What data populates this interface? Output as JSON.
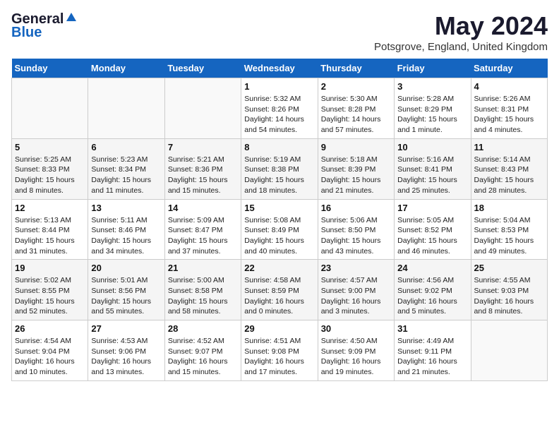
{
  "header": {
    "logo_general": "General",
    "logo_blue": "Blue",
    "main_title": "May 2024",
    "subtitle": "Potsgrove, England, United Kingdom"
  },
  "days_of_week": [
    "Sunday",
    "Monday",
    "Tuesday",
    "Wednesday",
    "Thursday",
    "Friday",
    "Saturday"
  ],
  "weeks": [
    {
      "days": [
        {
          "number": "",
          "info": ""
        },
        {
          "number": "",
          "info": ""
        },
        {
          "number": "",
          "info": ""
        },
        {
          "number": "1",
          "info": "Sunrise: 5:32 AM\nSunset: 8:26 PM\nDaylight: 14 hours\nand 54 minutes."
        },
        {
          "number": "2",
          "info": "Sunrise: 5:30 AM\nSunset: 8:28 PM\nDaylight: 14 hours\nand 57 minutes."
        },
        {
          "number": "3",
          "info": "Sunrise: 5:28 AM\nSunset: 8:29 PM\nDaylight: 15 hours\nand 1 minute."
        },
        {
          "number": "4",
          "info": "Sunrise: 5:26 AM\nSunset: 8:31 PM\nDaylight: 15 hours\nand 4 minutes."
        }
      ]
    },
    {
      "days": [
        {
          "number": "5",
          "info": "Sunrise: 5:25 AM\nSunset: 8:33 PM\nDaylight: 15 hours\nand 8 minutes."
        },
        {
          "number": "6",
          "info": "Sunrise: 5:23 AM\nSunset: 8:34 PM\nDaylight: 15 hours\nand 11 minutes."
        },
        {
          "number": "7",
          "info": "Sunrise: 5:21 AM\nSunset: 8:36 PM\nDaylight: 15 hours\nand 15 minutes."
        },
        {
          "number": "8",
          "info": "Sunrise: 5:19 AM\nSunset: 8:38 PM\nDaylight: 15 hours\nand 18 minutes."
        },
        {
          "number": "9",
          "info": "Sunrise: 5:18 AM\nSunset: 8:39 PM\nDaylight: 15 hours\nand 21 minutes."
        },
        {
          "number": "10",
          "info": "Sunrise: 5:16 AM\nSunset: 8:41 PM\nDaylight: 15 hours\nand 25 minutes."
        },
        {
          "number": "11",
          "info": "Sunrise: 5:14 AM\nSunset: 8:43 PM\nDaylight: 15 hours\nand 28 minutes."
        }
      ]
    },
    {
      "days": [
        {
          "number": "12",
          "info": "Sunrise: 5:13 AM\nSunset: 8:44 PM\nDaylight: 15 hours\nand 31 minutes."
        },
        {
          "number": "13",
          "info": "Sunrise: 5:11 AM\nSunset: 8:46 PM\nDaylight: 15 hours\nand 34 minutes."
        },
        {
          "number": "14",
          "info": "Sunrise: 5:09 AM\nSunset: 8:47 PM\nDaylight: 15 hours\nand 37 minutes."
        },
        {
          "number": "15",
          "info": "Sunrise: 5:08 AM\nSunset: 8:49 PM\nDaylight: 15 hours\nand 40 minutes."
        },
        {
          "number": "16",
          "info": "Sunrise: 5:06 AM\nSunset: 8:50 PM\nDaylight: 15 hours\nand 43 minutes."
        },
        {
          "number": "17",
          "info": "Sunrise: 5:05 AM\nSunset: 8:52 PM\nDaylight: 15 hours\nand 46 minutes."
        },
        {
          "number": "18",
          "info": "Sunrise: 5:04 AM\nSunset: 8:53 PM\nDaylight: 15 hours\nand 49 minutes."
        }
      ]
    },
    {
      "days": [
        {
          "number": "19",
          "info": "Sunrise: 5:02 AM\nSunset: 8:55 PM\nDaylight: 15 hours\nand 52 minutes."
        },
        {
          "number": "20",
          "info": "Sunrise: 5:01 AM\nSunset: 8:56 PM\nDaylight: 15 hours\nand 55 minutes."
        },
        {
          "number": "21",
          "info": "Sunrise: 5:00 AM\nSunset: 8:58 PM\nDaylight: 15 hours\nand 58 minutes."
        },
        {
          "number": "22",
          "info": "Sunrise: 4:58 AM\nSunset: 8:59 PM\nDaylight: 16 hours\nand 0 minutes."
        },
        {
          "number": "23",
          "info": "Sunrise: 4:57 AM\nSunset: 9:00 PM\nDaylight: 16 hours\nand 3 minutes."
        },
        {
          "number": "24",
          "info": "Sunrise: 4:56 AM\nSunset: 9:02 PM\nDaylight: 16 hours\nand 5 minutes."
        },
        {
          "number": "25",
          "info": "Sunrise: 4:55 AM\nSunset: 9:03 PM\nDaylight: 16 hours\nand 8 minutes."
        }
      ]
    },
    {
      "days": [
        {
          "number": "26",
          "info": "Sunrise: 4:54 AM\nSunset: 9:04 PM\nDaylight: 16 hours\nand 10 minutes."
        },
        {
          "number": "27",
          "info": "Sunrise: 4:53 AM\nSunset: 9:06 PM\nDaylight: 16 hours\nand 13 minutes."
        },
        {
          "number": "28",
          "info": "Sunrise: 4:52 AM\nSunset: 9:07 PM\nDaylight: 16 hours\nand 15 minutes."
        },
        {
          "number": "29",
          "info": "Sunrise: 4:51 AM\nSunset: 9:08 PM\nDaylight: 16 hours\nand 17 minutes."
        },
        {
          "number": "30",
          "info": "Sunrise: 4:50 AM\nSunset: 9:09 PM\nDaylight: 16 hours\nand 19 minutes."
        },
        {
          "number": "31",
          "info": "Sunrise: 4:49 AM\nSunset: 9:11 PM\nDaylight: 16 hours\nand 21 minutes."
        },
        {
          "number": "",
          "info": ""
        }
      ]
    }
  ]
}
